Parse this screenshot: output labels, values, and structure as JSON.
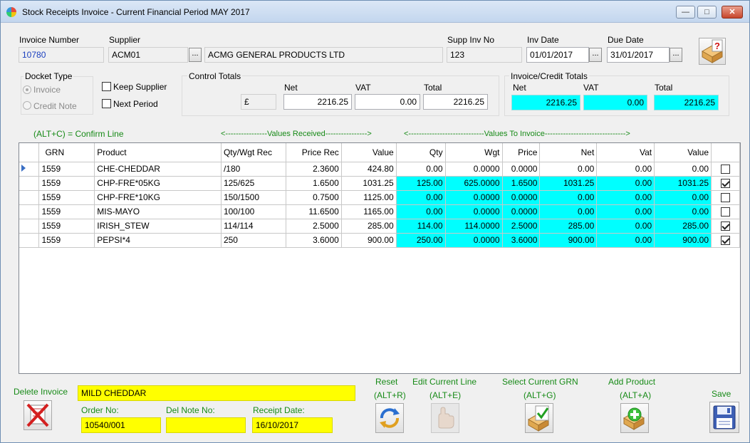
{
  "window": {
    "title": "Stock Receipts Invoice - Current Financial Period MAY 2017"
  },
  "header": {
    "invoice_number_label": "Invoice Number",
    "invoice_number": "10780",
    "supplier_label": "Supplier",
    "supplier_code": "ACM01",
    "supplier_name": "ACMG GENERAL PRODUCTS LTD",
    "browse_label": "...",
    "supp_inv_no_label": "Supp Inv No",
    "supp_inv_no": "123",
    "inv_date_label": "Inv Date",
    "inv_date": "01/01/2017",
    "due_date_label": "Due Date",
    "due_date": "31/01/2017"
  },
  "docket_type": {
    "label": "Docket Type",
    "invoice": "Invoice",
    "credit_note": "Credit Note",
    "selected": "Invoice"
  },
  "options": {
    "keep_supplier": "Keep Supplier",
    "next_period": "Next Period"
  },
  "control_totals": {
    "label": "Control Totals",
    "currency": "£",
    "net_label": "Net",
    "vat_label": "VAT",
    "total_label": "Total",
    "net": "2216.25",
    "vat": "0.00",
    "total": "2216.25"
  },
  "invoice_totals": {
    "label": "Invoice/Credit Totals",
    "net_label": "Net",
    "vat_label": "VAT",
    "total_label": "Total",
    "net": "2216.25",
    "vat": "0.00",
    "total": "2216.25"
  },
  "banner": {
    "confirm_hint": "(ALT+C) = Confirm Line",
    "values_received": "<----------------Values Received---------------->",
    "values_to_invoice": "<-----------------------------Values To Invoice------------------------------->"
  },
  "grid": {
    "columns": [
      "GRN",
      "Product",
      "Qty/Wgt Rec",
      "Price Rec",
      "Value",
      "Qty",
      "Wgt",
      "Price",
      "Net",
      "Vat",
      "Value"
    ],
    "rows": [
      {
        "grn": "1559",
        "product": "CHE-CHEDDAR",
        "qty_rec": "/180",
        "price_rec": "2.3600",
        "value": "424.80",
        "qty": "0.00",
        "wgt": "0.0000",
        "price": "0.0000",
        "net": "0.00",
        "vat": "0.00",
        "inv_value": "0.00",
        "checked": false
      },
      {
        "grn": "1559",
        "product": "CHP-FRE*05KG",
        "qty_rec": "125/625",
        "price_rec": "1.6500",
        "value": "1031.25",
        "qty": "125.00",
        "wgt": "625.0000",
        "price": "1.6500",
        "net": "1031.25",
        "vat": "0.00",
        "inv_value": "1031.25",
        "checked": true
      },
      {
        "grn": "1559",
        "product": "CHP-FRE*10KG",
        "qty_rec": "150/1500",
        "price_rec": "0.7500",
        "value": "1125.00",
        "qty": "0.00",
        "wgt": "0.0000",
        "price": "0.0000",
        "net": "0.00",
        "vat": "0.00",
        "inv_value": "0.00",
        "checked": false
      },
      {
        "grn": "1559",
        "product": "MIS-MAYO",
        "qty_rec": "100/100",
        "price_rec": "11.6500",
        "value": "1165.00",
        "qty": "0.00",
        "wgt": "0.0000",
        "price": "0.0000",
        "net": "0.00",
        "vat": "0.00",
        "inv_value": "0.00",
        "checked": false
      },
      {
        "grn": "1559",
        "product": "IRISH_STEW",
        "qty_rec": "114/114",
        "price_rec": "2.5000",
        "value": "285.00",
        "qty": "114.00",
        "wgt": "114.0000",
        "price": "2.5000",
        "net": "285.00",
        "vat": "0.00",
        "inv_value": "285.00",
        "checked": true
      },
      {
        "grn": "1559",
        "product": "PEPSI*4",
        "qty_rec": "250",
        "price_rec": "3.6000",
        "value": "900.00",
        "qty": "250.00",
        "wgt": "0.0000",
        "price": "3.6000",
        "net": "900.00",
        "vat": "0.00",
        "inv_value": "900.00",
        "checked": true
      }
    ]
  },
  "footer": {
    "delete_invoice": "Delete Invoice",
    "product_desc": "MILD CHEDDAR",
    "order_no_label": "Order No:",
    "order_no": "10540/001",
    "del_note_label": "Del Note No:",
    "del_note": "",
    "receipt_date_label": "Receipt Date:",
    "receipt_date": "16/10/2017",
    "reset": "Reset",
    "reset_key": "(ALT+R)",
    "edit_line": "Edit Current Line",
    "edit_key": "(ALT+E)",
    "select_grn": "Select Current GRN",
    "select_key": "(ALT+G)",
    "add_product": "Add Product",
    "add_key": "(ALT+A)",
    "save": "Save"
  },
  "colors": {
    "cyan": "#00ffff",
    "yellow": "#ffff00",
    "green_label": "#178a17",
    "link_blue": "#1a3fbf"
  }
}
